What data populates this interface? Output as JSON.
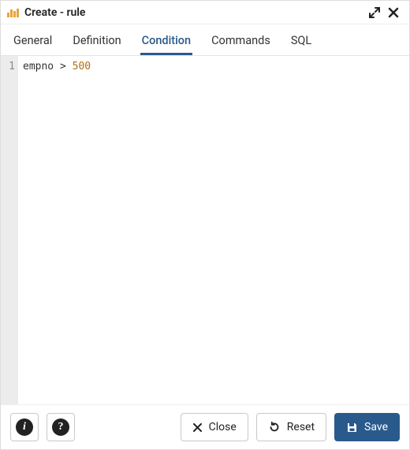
{
  "window": {
    "title": "Create - rule"
  },
  "tabs": [
    {
      "label": "General",
      "active": false
    },
    {
      "label": "Definition",
      "active": false
    },
    {
      "label": "Condition",
      "active": true
    },
    {
      "label": "Commands",
      "active": false
    },
    {
      "label": "SQL",
      "active": false
    }
  ],
  "editor": {
    "line_number": "1",
    "tokens": {
      "ident": "empno",
      "op": ">",
      "num": "500"
    }
  },
  "footer": {
    "close_label": "Close",
    "reset_label": "Reset",
    "save_label": "Save"
  }
}
